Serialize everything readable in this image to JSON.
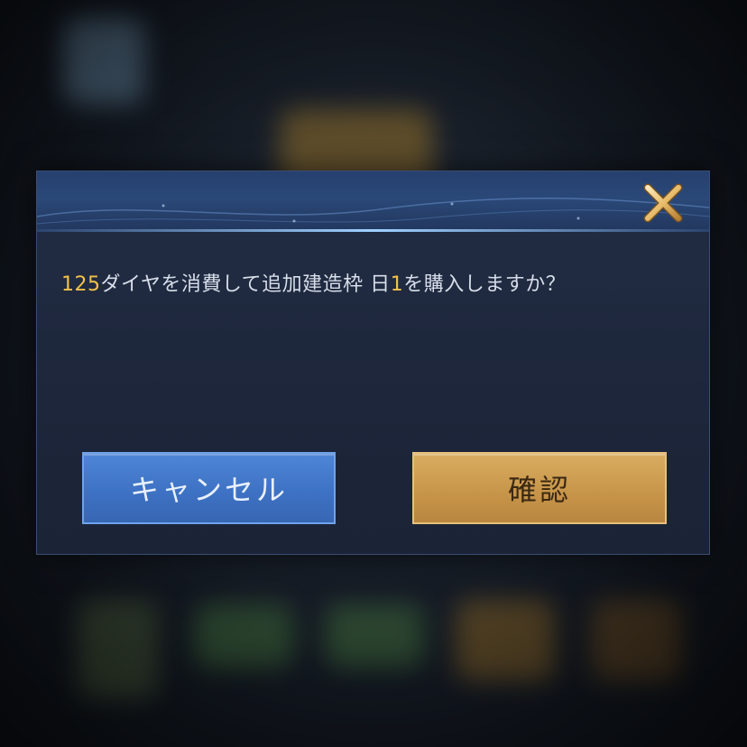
{
  "dialog": {
    "message": {
      "amount": "125",
      "text_before_day": "ダイヤを消費して追加建造枠 日",
      "day": "1",
      "text_after_day": "を購入しますか？"
    },
    "cancel_label": "キャンセル",
    "confirm_label": "確認",
    "close_icon": "close-x-icon"
  },
  "colors": {
    "highlight": "#f1c24a",
    "cancel_button": "#3e72c4",
    "confirm_button": "#c8964a",
    "dialog_bg": "#1d263a"
  }
}
